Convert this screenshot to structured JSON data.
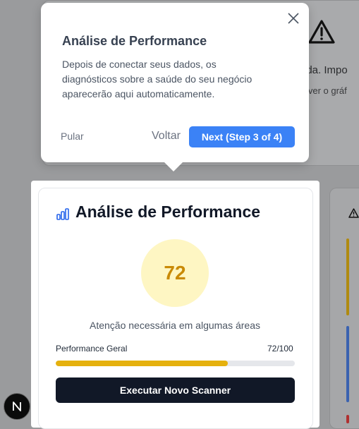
{
  "background": {
    "text_line1": "ada. Impo",
    "text_line2": "a ver o gráf",
    "warning_icon": "warning-icon"
  },
  "card": {
    "icon": "bar-chart-icon",
    "title": "Análise de Performance",
    "score": "72",
    "status": "Atenção necessária em algumas áreas",
    "metric_label": "Performance Geral",
    "metric_value": "72/100",
    "progress_percent": 72,
    "button_label": "Executar Novo Scanner"
  },
  "tooltip": {
    "title": "Análise de Performance",
    "body": "Depois de conectar seus dados, os diagnósticos sobre a saúde do seu negócio aparecerão aqui automaticamente.",
    "skip_label": "Pular",
    "back_label": "Voltar",
    "next_label": "Next (Step 3 of 4)"
  },
  "badge": {
    "letter": "N"
  },
  "colors": {
    "accent": "#3b82f6",
    "progress": "#e5b10e",
    "score": "#c98a06",
    "score_bg": "#fef6c3",
    "button_dark": "#111827"
  }
}
